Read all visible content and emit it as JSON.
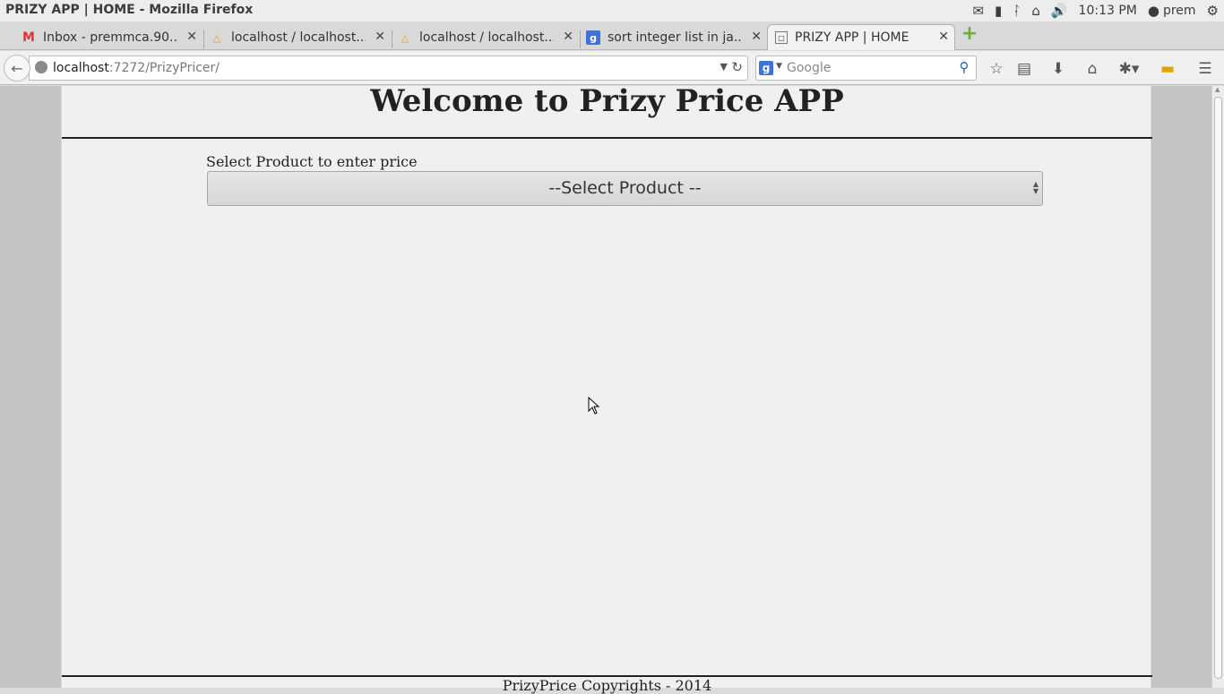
{
  "window": {
    "title": "PRIZY APP | HOME - Mozilla Firefox"
  },
  "tray": {
    "clock": "10:13 PM",
    "user": "prem",
    "icons": [
      "mail-icon",
      "battery-icon",
      "bluetooth-icon",
      "wifi-icon",
      "volume-icon",
      "user-icon",
      "gear-icon"
    ]
  },
  "tabs": [
    {
      "label": "Inbox - premmca.90...",
      "favicon": "gmail-icon",
      "active": false
    },
    {
      "label": "localhost / localhost...",
      "favicon": "phpmyadmin-icon",
      "active": false
    },
    {
      "label": "localhost / localhost...",
      "favicon": "phpmyadmin-icon",
      "active": false
    },
    {
      "label": "sort integer list in ja...",
      "favicon": "google-icon",
      "active": false
    },
    {
      "label": "PRIZY APP | HOME",
      "favicon": "page-icon",
      "active": true
    }
  ],
  "nav": {
    "url_host": "localhost",
    "url_rest": ":7272/PrizyPricer/",
    "search_placeholder": "Google"
  },
  "page": {
    "heading": "Welcome to Prizy Price APP",
    "select_label": "Select Product to enter price",
    "select_value": "--Select Product --",
    "footer": "PrizyPrice Copyrights - 2014"
  },
  "colors": {
    "page_bg": "#f0f0f0",
    "outer_bg": "#c4c4c4",
    "rule": "#222222"
  }
}
